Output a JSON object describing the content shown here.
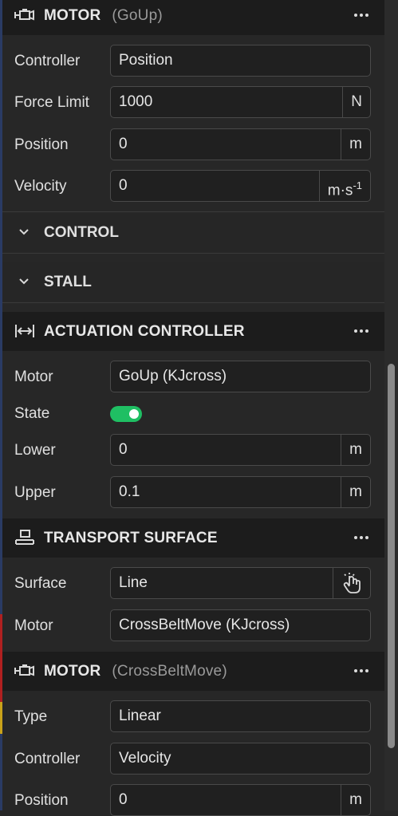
{
  "colors": {
    "accent_green": "#1fbf63",
    "header_bg": "#1c1c1c",
    "panel_bg": "#272727"
  },
  "motor1": {
    "title": "MOTOR",
    "subtitle": "(GoUp)",
    "rows": [
      {
        "label": "Controller",
        "value": "Position"
      },
      {
        "label": "Force Limit",
        "value": "1000",
        "unit": "N"
      },
      {
        "label": "Position",
        "value": "0",
        "unit": "m"
      },
      {
        "label": "Velocity",
        "value": "0",
        "unit": "m·s",
        "unit_sup": "-1"
      }
    ]
  },
  "sections": {
    "control": "CONTROL",
    "stall": "STALL"
  },
  "actuation": {
    "title": "ACTUATION CONTROLLER",
    "motor_label": "Motor",
    "motor_value": "GoUp (KJcross)",
    "state_label": "State",
    "state_on": true,
    "lower_label": "Lower",
    "lower_value": "0",
    "lower_unit": "m",
    "upper_label": "Upper",
    "upper_value": "0.1",
    "upper_unit": "m"
  },
  "transport": {
    "title": "TRANSPORT SURFACE",
    "surface_label": "Surface",
    "surface_value": "Line",
    "motor_label": "Motor",
    "motor_value": "CrossBeltMove (KJcross)"
  },
  "motor2": {
    "title": "MOTOR",
    "subtitle": "(CrossBeltMove)",
    "type_label": "Type",
    "type_value": "Linear",
    "controller_label": "Controller",
    "controller_value": "Velocity",
    "position_label": "Position",
    "position_value": "0",
    "position_unit": "m"
  },
  "icons": {
    "motor": "motor-icon",
    "actuation": "actuation-icon",
    "transport": "transport-icon",
    "more": "more-dots-icon",
    "chevron": "chevron-down-icon",
    "pick": "pick-hand-icon"
  }
}
